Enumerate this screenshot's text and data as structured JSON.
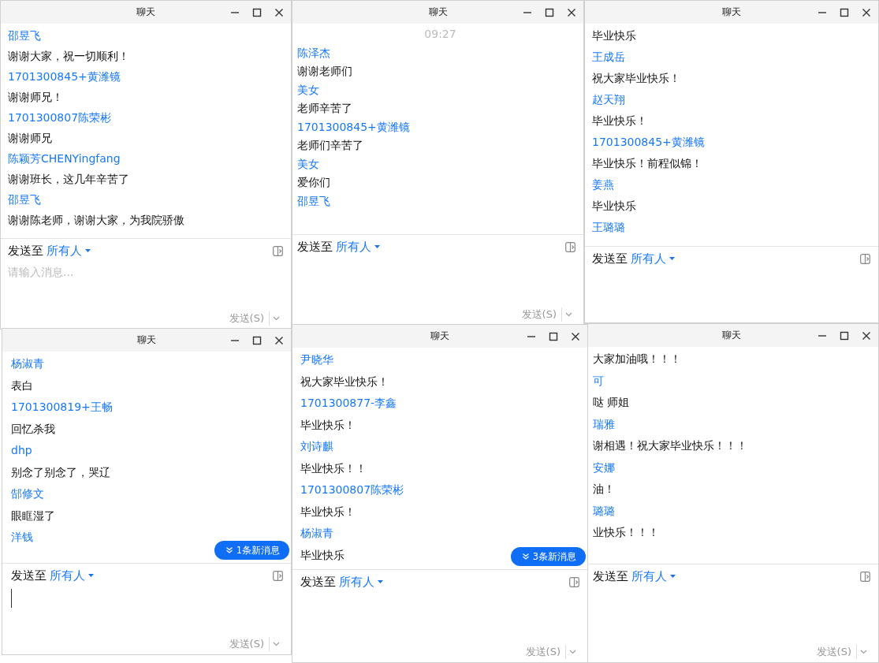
{
  "windows": [
    {
      "title": "聊天",
      "messages": [
        {
          "kind": "sender",
          "text": "邵昱飞"
        },
        {
          "kind": "message",
          "text": "谢谢大家，祝一切顺利！"
        },
        {
          "kind": "sender",
          "text": "1701300845+黄潍镜"
        },
        {
          "kind": "message",
          "text": "谢谢师兄！"
        },
        {
          "kind": "sender",
          "text": "1701300807陈荣彬"
        },
        {
          "kind": "message",
          "text": "谢谢师兄"
        },
        {
          "kind": "sender",
          "text": "陈颖芳CHENYingfang"
        },
        {
          "kind": "message",
          "text": "谢谢班长，这几年辛苦了"
        },
        {
          "kind": "sender",
          "text": "邵昱飞"
        },
        {
          "kind": "message",
          "text": "谢谢陈老师，谢谢大家，为我院骄傲"
        }
      ],
      "send_to_label": "发送至",
      "recipient": "所有人",
      "input": {
        "placeholder": "请输入消息...",
        "focused": false
      },
      "send_button": "发送(S)"
    },
    {
      "title": "聊天",
      "messages": [
        {
          "kind": "time",
          "text": "09:27"
        },
        {
          "kind": "sender",
          "text": "陈泽杰"
        },
        {
          "kind": "message",
          "text": "谢谢老师们"
        },
        {
          "kind": "sender",
          "text": "美女"
        },
        {
          "kind": "message",
          "text": "老师辛苦了"
        },
        {
          "kind": "sender",
          "text": "1701300845+黄潍镜"
        },
        {
          "kind": "message",
          "text": "老师们辛苦了"
        },
        {
          "kind": "sender",
          "text": "美女"
        },
        {
          "kind": "message",
          "text": "爱你们"
        },
        {
          "kind": "sender",
          "text": "邵昱飞"
        }
      ],
      "send_to_label": "发送至",
      "recipient": "所有人",
      "send_button": "发送(S)"
    },
    {
      "title": "聊天",
      "messages": [
        {
          "kind": "message",
          "text": "毕业快乐"
        },
        {
          "kind": "sender",
          "text": "王成岳"
        },
        {
          "kind": "message",
          "text": "祝大家毕业快乐！"
        },
        {
          "kind": "sender",
          "text": "赵天翔"
        },
        {
          "kind": "message",
          "text": "毕业快乐！"
        },
        {
          "kind": "sender",
          "text": "1701300845+黄潍镜"
        },
        {
          "kind": "message",
          "text": "毕业快乐！前程似锦！"
        },
        {
          "kind": "sender",
          "text": "姜燕"
        },
        {
          "kind": "message",
          "text": "毕业快乐"
        },
        {
          "kind": "sender",
          "text": "王璐璐"
        }
      ],
      "send_to_label": "发送至",
      "recipient": "所有人"
    },
    {
      "title": "聊天",
      "messages": [
        {
          "kind": "sender",
          "text": "杨淑青"
        },
        {
          "kind": "message",
          "text": "表白"
        },
        {
          "kind": "sender",
          "text": "1701300819+王畅"
        },
        {
          "kind": "message",
          "text": "回忆杀我"
        },
        {
          "kind": "sender",
          "text": "dhp"
        },
        {
          "kind": "message",
          "text": "别念了别念了，哭辽"
        },
        {
          "kind": "sender",
          "text": "郜修文"
        },
        {
          "kind": "message",
          "text": "眼眶湿了"
        },
        {
          "kind": "sender",
          "text": "洋钱"
        }
      ],
      "new_messages": "1条新消息",
      "send_to_label": "发送至",
      "recipient": "所有人",
      "input": {
        "focused": true
      },
      "send_button": "发送(S)"
    },
    {
      "title": "聊天",
      "messages": [
        {
          "kind": "sender",
          "text": "尹晓华"
        },
        {
          "kind": "message",
          "text": "祝大家毕业快乐！"
        },
        {
          "kind": "sender",
          "text": "1701300877-李鑫"
        },
        {
          "kind": "message",
          "text": "毕业快乐！"
        },
        {
          "kind": "sender",
          "text": "刘诗麒"
        },
        {
          "kind": "message",
          "text": "毕业快乐！！"
        },
        {
          "kind": "sender",
          "text": "1701300807陈荣彬"
        },
        {
          "kind": "message",
          "text": "毕业快乐！"
        },
        {
          "kind": "sender",
          "text": "杨淑青"
        },
        {
          "kind": "message",
          "text": "毕业快乐"
        }
      ],
      "new_messages": "3条新消息",
      "send_to_label": "发送至",
      "recipient": "所有人",
      "send_button": "发送(S)"
    },
    {
      "title": "聊天",
      "messages": [
        {
          "kind": "message",
          "text": "大家加油哦！！！"
        },
        {
          "kind": "sender",
          "text": "可"
        },
        {
          "kind": "message",
          "text": "哒 师姐"
        },
        {
          "kind": "sender",
          "text": "瑞雅"
        },
        {
          "kind": "message",
          "text": "谢相遇！祝大家毕业快乐！！！"
        },
        {
          "kind": "sender",
          "text": "安娜"
        },
        {
          "kind": "message",
          "text": "油！"
        },
        {
          "kind": "sender",
          "text": "璐璐"
        },
        {
          "kind": "message",
          "text": "业快乐！！！"
        }
      ],
      "send_to_label": "发送至",
      "recipient": "所有人",
      "send_button": "发送(S)"
    }
  ]
}
